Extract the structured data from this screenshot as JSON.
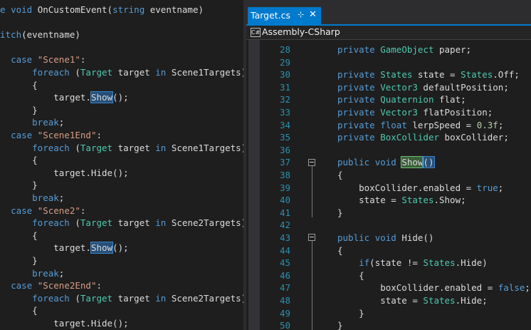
{
  "left_editor": {
    "lines": [
      [
        {
          "t": "e ",
          "c": "kw"
        },
        {
          "t": "void",
          "c": "kw"
        },
        {
          "t": " OnCustomEvent(",
          "c": ""
        },
        {
          "t": "string",
          "c": "kw"
        },
        {
          "t": " eventname)",
          "c": ""
        }
      ],
      [],
      [
        {
          "t": "itch",
          "c": "kw"
        },
        {
          "t": "(eventname)",
          "c": ""
        }
      ],
      [],
      [
        {
          "t": "  ",
          "c": ""
        },
        {
          "t": "case",
          "c": "kw"
        },
        {
          "t": " ",
          "c": ""
        },
        {
          "t": "\"Scene1\"",
          "c": "st"
        },
        {
          "t": ":",
          "c": ""
        }
      ],
      [
        {
          "t": "      ",
          "c": ""
        },
        {
          "t": "foreach",
          "c": "kw"
        },
        {
          "t": " (",
          "c": ""
        },
        {
          "t": "Target",
          "c": "ty"
        },
        {
          "t": " target ",
          "c": ""
        },
        {
          "t": "in",
          "c": "kw"
        },
        {
          "t": " Scene1Targets)",
          "c": ""
        }
      ],
      [
        {
          "t": "      {",
          "c": ""
        }
      ],
      [
        {
          "t": "          target.",
          "c": ""
        },
        {
          "t": "Show",
          "c": "hlb"
        },
        {
          "t": "();",
          "c": ""
        }
      ],
      [
        {
          "t": "      }",
          "c": ""
        }
      ],
      [
        {
          "t": "      ",
          "c": ""
        },
        {
          "t": "break",
          "c": "kw"
        },
        {
          "t": ";",
          "c": ""
        }
      ],
      [
        {
          "t": "  ",
          "c": ""
        },
        {
          "t": "case",
          "c": "kw"
        },
        {
          "t": " ",
          "c": ""
        },
        {
          "t": "\"Scene1End\"",
          "c": "st"
        },
        {
          "t": ":",
          "c": ""
        }
      ],
      [
        {
          "t": "      ",
          "c": ""
        },
        {
          "t": "foreach",
          "c": "kw"
        },
        {
          "t": " (",
          "c": ""
        },
        {
          "t": "Target",
          "c": "ty"
        },
        {
          "t": " target ",
          "c": ""
        },
        {
          "t": "in",
          "c": "kw"
        },
        {
          "t": " Scene1Targets)",
          "c": ""
        }
      ],
      [
        {
          "t": "      {",
          "c": ""
        }
      ],
      [
        {
          "t": "          target.Hide();",
          "c": ""
        }
      ],
      [
        {
          "t": "      }",
          "c": ""
        }
      ],
      [
        {
          "t": "      ",
          "c": ""
        },
        {
          "t": "break",
          "c": "kw"
        },
        {
          "t": ";",
          "c": ""
        }
      ],
      [
        {
          "t": "  ",
          "c": ""
        },
        {
          "t": "case",
          "c": "kw"
        },
        {
          "t": " ",
          "c": ""
        },
        {
          "t": "\"Scene2\"",
          "c": "st"
        },
        {
          "t": ":",
          "c": ""
        }
      ],
      [
        {
          "t": "      ",
          "c": ""
        },
        {
          "t": "foreach",
          "c": "kw"
        },
        {
          "t": " (",
          "c": ""
        },
        {
          "t": "Target",
          "c": "ty"
        },
        {
          "t": " target ",
          "c": ""
        },
        {
          "t": "in",
          "c": "kw"
        },
        {
          "t": " Scene2Targets)",
          "c": ""
        }
      ],
      [
        {
          "t": "      {",
          "c": ""
        }
      ],
      [
        {
          "t": "          target.",
          "c": ""
        },
        {
          "t": "Show",
          "c": "hlb"
        },
        {
          "t": "();",
          "c": ""
        }
      ],
      [
        {
          "t": "      }",
          "c": ""
        }
      ],
      [
        {
          "t": "      ",
          "c": ""
        },
        {
          "t": "break",
          "c": "kw"
        },
        {
          "t": ";",
          "c": ""
        }
      ],
      [
        {
          "t": "  ",
          "c": ""
        },
        {
          "t": "case",
          "c": "kw"
        },
        {
          "t": " ",
          "c": ""
        },
        {
          "t": "\"Scene2End\"",
          "c": "st"
        },
        {
          "t": ":",
          "c": ""
        }
      ],
      [
        {
          "t": "      ",
          "c": ""
        },
        {
          "t": "foreach",
          "c": "kw"
        },
        {
          "t": " (",
          "c": ""
        },
        {
          "t": "Target",
          "c": "ty"
        },
        {
          "t": " target ",
          "c": ""
        },
        {
          "t": "in",
          "c": "kw"
        },
        {
          "t": " Scene2Targets)",
          "c": ""
        }
      ],
      [
        {
          "t": "      {",
          "c": ""
        }
      ],
      [
        {
          "t": "          target.Hide();",
          "c": ""
        }
      ]
    ]
  },
  "right_editor": {
    "tab": {
      "title": "Target.cs",
      "pin_glyph": "⊹",
      "close_glyph": "✕"
    },
    "navbar": {
      "icon_label": "C#",
      "project": "Assembly-CSharp"
    },
    "lines": [
      {
        "n": "28",
        "parts": [
          {
            "t": "private",
            "c": "kw"
          },
          {
            "t": " ",
            "c": ""
          },
          {
            "t": "GameObject",
            "c": "ty"
          },
          {
            "t": " paper;",
            "c": ""
          }
        ]
      },
      {
        "n": "29",
        "parts": []
      },
      {
        "n": "30",
        "parts": [
          {
            "t": "private",
            "c": "kw"
          },
          {
            "t": " ",
            "c": ""
          },
          {
            "t": "States",
            "c": "ty"
          },
          {
            "t": " state = ",
            "c": ""
          },
          {
            "t": "States",
            "c": "ty"
          },
          {
            "t": ".Off;",
            "c": ""
          }
        ]
      },
      {
        "n": "31",
        "parts": [
          {
            "t": "private",
            "c": "kw"
          },
          {
            "t": " ",
            "c": ""
          },
          {
            "t": "Vector3",
            "c": "ty"
          },
          {
            "t": " defaultPosition;",
            "c": ""
          }
        ]
      },
      {
        "n": "32",
        "parts": [
          {
            "t": "private",
            "c": "kw"
          },
          {
            "t": " ",
            "c": ""
          },
          {
            "t": "Quaternion",
            "c": "ty"
          },
          {
            "t": " flat;",
            "c": ""
          }
        ]
      },
      {
        "n": "33",
        "parts": [
          {
            "t": "private",
            "c": "kw"
          },
          {
            "t": " ",
            "c": ""
          },
          {
            "t": "Vector3",
            "c": "ty"
          },
          {
            "t": " flatPosition;",
            "c": ""
          }
        ]
      },
      {
        "n": "34",
        "parts": [
          {
            "t": "private",
            "c": "kw"
          },
          {
            "t": " ",
            "c": ""
          },
          {
            "t": "float",
            "c": "kw"
          },
          {
            "t": " lerpSpeed = ",
            "c": ""
          },
          {
            "t": "0.3f",
            "c": "nu"
          },
          {
            "t": ";",
            "c": ""
          }
        ]
      },
      {
        "n": "35",
        "parts": [
          {
            "t": "private",
            "c": "kw"
          },
          {
            "t": " ",
            "c": ""
          },
          {
            "t": "BoxCollider",
            "c": "ty"
          },
          {
            "t": " boxCollider;",
            "c": ""
          }
        ]
      },
      {
        "n": "36",
        "parts": []
      },
      {
        "n": "37",
        "parts": [
          {
            "t": "public",
            "c": "kw"
          },
          {
            "t": " ",
            "c": ""
          },
          {
            "t": "void",
            "c": "kw"
          },
          {
            "t": " ",
            "c": ""
          },
          {
            "t": "Show",
            "c": "hlg"
          },
          {
            "t": "()",
            "c": "hlb"
          }
        ]
      },
      {
        "n": "38",
        "parts": [
          {
            "t": "{",
            "c": ""
          }
        ]
      },
      {
        "n": "39",
        "parts": [
          {
            "t": "    boxCollider.enabled = ",
            "c": ""
          },
          {
            "t": "true",
            "c": "kw"
          },
          {
            "t": ";",
            "c": ""
          }
        ]
      },
      {
        "n": "40",
        "parts": [
          {
            "t": "    state = ",
            "c": ""
          },
          {
            "t": "States",
            "c": "ty"
          },
          {
            "t": ".Show;",
            "c": ""
          }
        ]
      },
      {
        "n": "41",
        "parts": [
          {
            "t": "}",
            "c": ""
          }
        ]
      },
      {
        "n": "42",
        "parts": []
      },
      {
        "n": "43",
        "parts": [
          {
            "t": "public",
            "c": "kw"
          },
          {
            "t": " ",
            "c": ""
          },
          {
            "t": "void",
            "c": "kw"
          },
          {
            "t": " Hide()",
            "c": ""
          }
        ]
      },
      {
        "n": "44",
        "parts": [
          {
            "t": "{",
            "c": ""
          }
        ]
      },
      {
        "n": "45",
        "parts": [
          {
            "t": "    ",
            "c": ""
          },
          {
            "t": "if",
            "c": "kw"
          },
          {
            "t": "(state != ",
            "c": ""
          },
          {
            "t": "States",
            "c": "ty"
          },
          {
            "t": ".Hide)",
            "c": ""
          }
        ]
      },
      {
        "n": "46",
        "parts": [
          {
            "t": "    {",
            "c": ""
          }
        ]
      },
      {
        "n": "47",
        "parts": [
          {
            "t": "        boxCollider.enabled = ",
            "c": ""
          },
          {
            "t": "false",
            "c": "kw"
          },
          {
            "t": ";",
            "c": ""
          }
        ]
      },
      {
        "n": "48",
        "parts": [
          {
            "t": "        state = ",
            "c": ""
          },
          {
            "t": "States",
            "c": "ty"
          },
          {
            "t": ".Hide;",
            "c": ""
          }
        ]
      },
      {
        "n": "49",
        "parts": [
          {
            "t": "    }",
            "c": ""
          }
        ]
      },
      {
        "n": "50",
        "parts": [
          {
            "t": "}",
            "c": ""
          }
        ]
      }
    ]
  },
  "colors": {
    "background": "#1e1e1e",
    "keyword": "#569cd6",
    "type": "#4ec9b0",
    "string": "#d69d85",
    "number": "#b5cea8",
    "line_number": "#2b91af",
    "accent": "#007acc"
  }
}
